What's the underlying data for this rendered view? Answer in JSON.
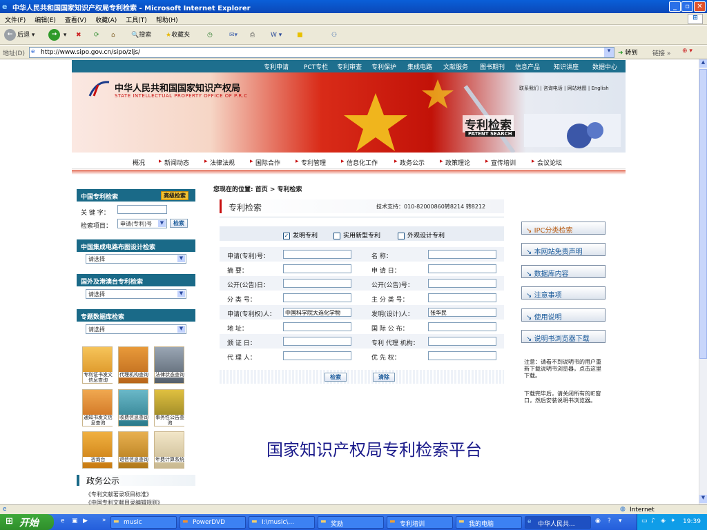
{
  "window": {
    "title": "中华人民共和国国家知识产权局专利检索 - Microsoft Internet Explorer"
  },
  "menu": [
    "文件(F)",
    "编辑(E)",
    "查看(V)",
    "收藏(A)",
    "工具(T)",
    "帮助(H)"
  ],
  "toolbar": {
    "back": "后退",
    "search": "搜索",
    "favorites": "收藏夹"
  },
  "address": {
    "label": "地址(D)",
    "url": "http://www.sipo.gov.cn/sipo/zljs/",
    "go": "转到",
    "links": "链接"
  },
  "site": {
    "top_nav": [
      "专利申请",
      "PCT专栏",
      "专利审查",
      "专利保护",
      "集成电路",
      "文献服务",
      "图书期刊",
      "信息产品",
      "知识讲座",
      "数据中心"
    ],
    "org_name": "中华人民共和国国家知识产权局",
    "org_name_en": "STATE INTELLECTUAL PROPERTY OFFICE OF P.R.C",
    "header_links": [
      "联系我们",
      "咨询电话",
      "网站地图",
      "English"
    ],
    "banner_title": "专利检索",
    "banner_subtitle": "PATENT SEARCH",
    "sub_nav": [
      "概况",
      "新闻动态",
      "法律法规",
      "国际合作",
      "专利管理",
      "信息化工作",
      "政务公示",
      "政策理论",
      "宣传培训",
      "会议论坛"
    ],
    "breadcrumb": "您现在的位置: 首页 > 专利检索",
    "section_title": "专利检索",
    "tech_support": "技术支持：010-82000860转8214  转8212",
    "sidebar": {
      "cn_patent": {
        "title": "中国专利检索",
        "advanced": "高级检索",
        "keyword_label": "关 键 字：",
        "item_label": "检索项目：",
        "item_value": "申请(专利)号",
        "search_btn": "检索"
      },
      "ic_title": "中国集成电路布图设计检索",
      "ic_select": "请选择",
      "hk_title": "国外及港澳台专利检索",
      "hk_select": "请选择",
      "theme_title": "专题数据库检索",
      "theme_select": "请选择",
      "tiles": [
        [
          "专利证书发文信息查询",
          "代理机构查询",
          "法律状态查询"
        ],
        [
          "通知书发文信息查询",
          "收费信息查询",
          "事务性公告查询"
        ],
        [
          "咨询台",
          "退信信息查询",
          "年费计算系统"
        ]
      ],
      "gov_title": "政务公示",
      "gov_items": [
        "《专利文献著录项目标准》",
        "《中国专利文献目录编辑规则》"
      ]
    },
    "form": {
      "types": [
        {
          "label": "发明专利",
          "checked": true
        },
        {
          "label": "实用新型专利",
          "checked": false
        },
        {
          "label": "外观设计专利",
          "checked": false
        }
      ],
      "rows": [
        {
          "l": "申请(专利)号：",
          "lv": "",
          "r": "名        称：",
          "rv": ""
        },
        {
          "l": "摘        要：",
          "lv": "",
          "r": "申    请    日：",
          "rv": ""
        },
        {
          "l": "公开(公告)日：",
          "lv": "",
          "r": "公开(公告)号：",
          "rv": ""
        },
        {
          "l": "分    类    号：",
          "lv": "",
          "r": "主  分  类  号：",
          "rv": ""
        },
        {
          "l": "申请(专利权)人：",
          "lv": "中国科学院大连化学物",
          "r": "发明(设计)人：",
          "rv": "张华民"
        },
        {
          "l": "地          址：",
          "lv": "",
          "r": "国  际  公  布：",
          "rv": ""
        },
        {
          "l": "颁    证    日：",
          "lv": "",
          "r": "专利 代理 机构：",
          "rv": ""
        },
        {
          "l": "代    理    人：",
          "lv": "",
          "r": "优    先    权：",
          "rv": ""
        }
      ],
      "search_btn": "检索",
      "clear_btn": "清除"
    },
    "right_buttons": [
      "IPC分类检索",
      "本网站免责声明",
      "数据库内容",
      "注意事项",
      "使用说明",
      "说明书浏览器下载"
    ],
    "note1": "注意：请看不到说明书的用户重新下载说明书浏览器，点击这里下载。",
    "note2": "下载完毕后，请关闭所有的IE窗口，然后安装说明书浏览器。",
    "slide_caption": "国家知识产权局专利检索平台"
  },
  "status": {
    "zone": "Internet"
  },
  "taskbar": {
    "start": "开始",
    "tasks": [
      "music",
      "PowerDVD",
      "I:\\music\\...",
      "奖励",
      "专利培训",
      "我的电脑",
      "中华人民共..."
    ],
    "clock": "19:39"
  }
}
